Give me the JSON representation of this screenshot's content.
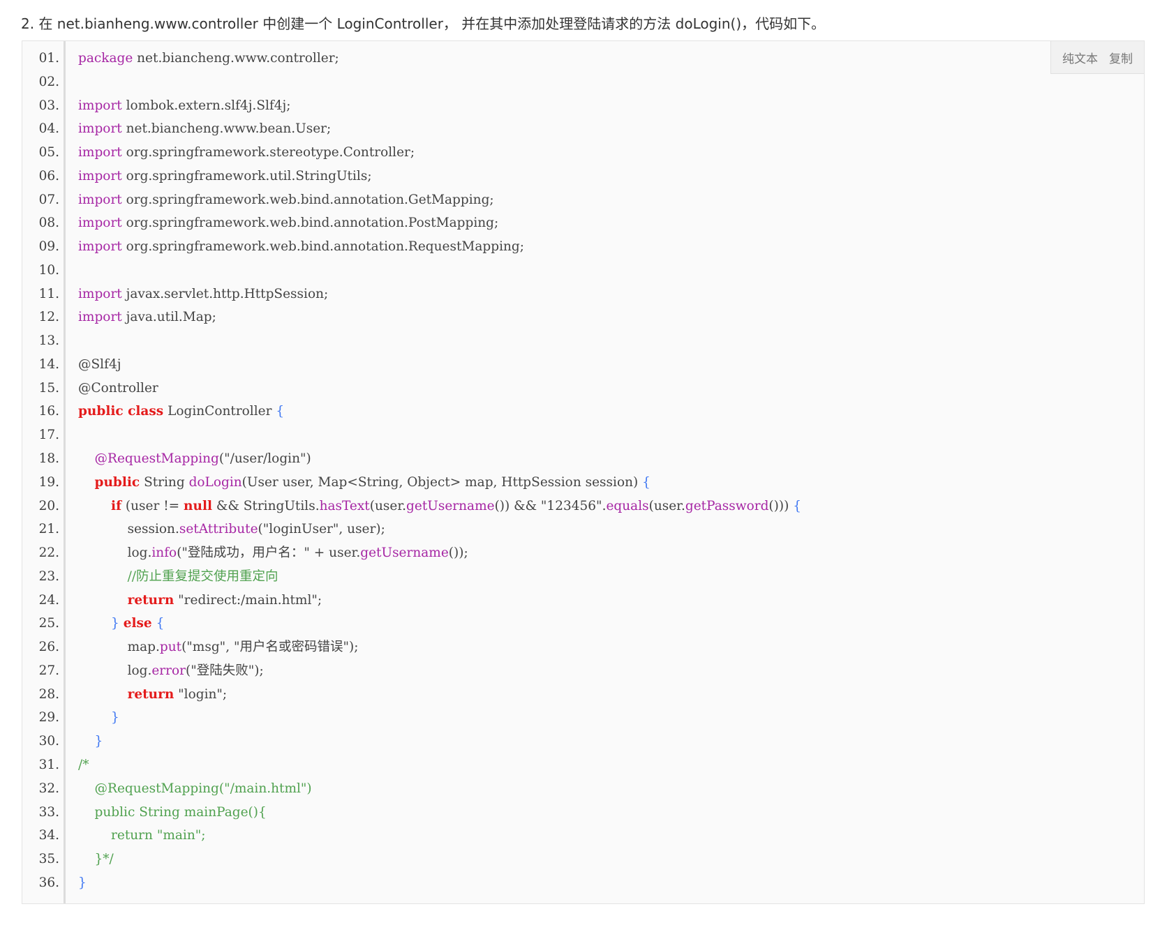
{
  "intro": "2. 在 net.bianheng.www.controller 中创建一个 LoginController， 并在其中添加处理登陆请求的方法 doLogin()，代码如下。",
  "toolbar": {
    "plain_text": "纯文本",
    "copy": "复制"
  },
  "code_lines": [
    {
      "n": "01.",
      "html": "<span class='kw'>package</span> net.biancheng.www.controller;"
    },
    {
      "n": "02.",
      "html": ""
    },
    {
      "n": "03.",
      "html": "<span class='kw'>import</span> lombok.extern.slf4j.Slf4j;"
    },
    {
      "n": "04.",
      "html": "<span class='kw'>import</span> net.biancheng.www.bean.User;"
    },
    {
      "n": "05.",
      "html": "<span class='kw'>import</span> org.springframework.stereotype.Controller;"
    },
    {
      "n": "06.",
      "html": "<span class='kw'>import</span> org.springframework.util.StringUtils;"
    },
    {
      "n": "07.",
      "html": "<span class='kw'>import</span> org.springframework.web.bind.annotation.GetMapping;"
    },
    {
      "n": "08.",
      "html": "<span class='kw'>import</span> org.springframework.web.bind.annotation.PostMapping;"
    },
    {
      "n": "09.",
      "html": "<span class='kw'>import</span> org.springframework.web.bind.annotation.RequestMapping;"
    },
    {
      "n": "10.",
      "html": ""
    },
    {
      "n": "11.",
      "html": "<span class='kw'>import</span> javax.servlet.http.HttpSession;"
    },
    {
      "n": "12.",
      "html": "<span class='kw'>import</span> java.util.Map;"
    },
    {
      "n": "13.",
      "html": ""
    },
    {
      "n": "14.",
      "html": "@Slf4j"
    },
    {
      "n": "15.",
      "html": "@Controller"
    },
    {
      "n": "16.",
      "html": "<span class='kw2'>public class</span> LoginController <span class='pun'>{</span>"
    },
    {
      "n": "17.",
      "html": ""
    },
    {
      "n": "18.",
      "html": "    <span class='ann'>@RequestMapping</span>(\"/user/login\")"
    },
    {
      "n": "19.",
      "html": "    <span class='kw2'>public</span> String <span class='fn'>doLogin</span>(User user, Map&lt;String, Object&gt; map, HttpSession session) <span class='pun'>{</span>"
    },
    {
      "n": "20.",
      "html": "        <span class='kw2'>if</span> (user != <span class='kw2'>null</span> &amp;&amp; StringUtils.<span class='fn'>hasText</span>(user.<span class='fn'>getUsername</span>()) &amp;&amp; \"123456\".<span class='fn'>equals</span>(user.<span class='fn'>getPassword</span>())) <span class='pun'>{</span>"
    },
    {
      "n": "21.",
      "html": "            session.<span class='fn'>setAttribute</span>(\"loginUser\", user);"
    },
    {
      "n": "22.",
      "html": "            log.<span class='fn'>info</span>(\"登陆成功，用户名：\" + user.<span class='fn'>getUsername</span>());"
    },
    {
      "n": "23.",
      "html": "            <span class='cm'>//防止重复提交使用重定向</span>"
    },
    {
      "n": "24.",
      "html": "            <span class='kw2'>return</span> \"redirect:/main.html\";"
    },
    {
      "n": "25.",
      "html": "        <span class='pun'>}</span> <span class='kw2'>else</span> <span class='pun'>{</span>"
    },
    {
      "n": "26.",
      "html": "            map.<span class='fn'>put</span>(\"msg\", \"用户名或密码错误\");"
    },
    {
      "n": "27.",
      "html": "            log.<span class='fn'>error</span>(\"登陆失败\");"
    },
    {
      "n": "28.",
      "html": "            <span class='kw2'>return</span> \"login\";"
    },
    {
      "n": "29.",
      "html": "        <span class='pun'>}</span>"
    },
    {
      "n": "30.",
      "html": "    <span class='pun'>}</span>"
    },
    {
      "n": "31.",
      "html": "<span class='cm'>/*</span>"
    },
    {
      "n": "32.",
      "html": "<span class='cm'>    @RequestMapping(\"/main.html\")</span>"
    },
    {
      "n": "33.",
      "html": "<span class='cm'>    public String mainPage(){</span>"
    },
    {
      "n": "34.",
      "html": "<span class='cm'>        return \"main\";</span>"
    },
    {
      "n": "35.",
      "html": "<span class='cm'>    }*/</span>"
    },
    {
      "n": "36.",
      "html": "<span class='pun'>}</span>"
    }
  ]
}
